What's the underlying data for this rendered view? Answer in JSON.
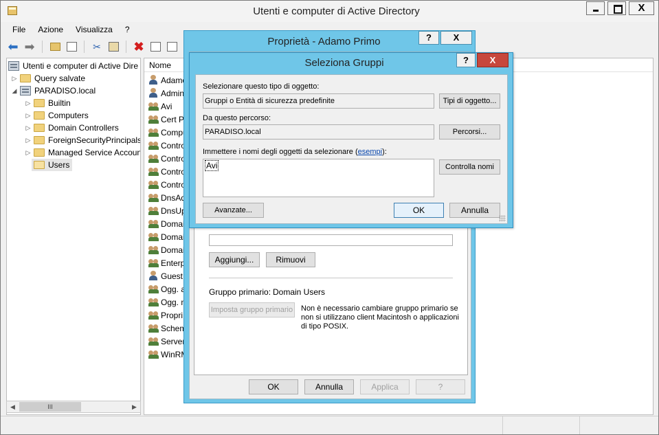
{
  "window": {
    "title": "Utenti e computer di Active Directory",
    "close_glyph": "X"
  },
  "menu": [
    "File",
    "Azione",
    "Visualizza",
    "?"
  ],
  "tree": {
    "root": "Utenti e computer di Active Dire",
    "items": [
      {
        "label": "Query salvate",
        "level": 1
      },
      {
        "label": "PARADISO.local",
        "level": 1
      },
      {
        "label": "Builtin",
        "level": 2
      },
      {
        "label": "Computers",
        "level": 2
      },
      {
        "label": "Domain Controllers",
        "level": 2
      },
      {
        "label": "ForeignSecurityPrincipals",
        "level": 2
      },
      {
        "label": "Managed Service Accoun",
        "level": 2
      },
      {
        "label": "Users",
        "level": 2
      }
    ],
    "scroll_thumb": "III"
  },
  "list": {
    "column_name": "Nome",
    "rows": [
      {
        "name": "Adamo",
        "kind": "user"
      },
      {
        "name": "Admin",
        "kind": "user"
      },
      {
        "name": "Avi",
        "kind": "group"
      },
      {
        "name": "Cert Pu",
        "kind": "group"
      },
      {
        "name": "Compu",
        "kind": "group"
      },
      {
        "name": "Contro",
        "kind": "group"
      },
      {
        "name": "Contro",
        "kind": "group"
      },
      {
        "name": "Contro",
        "kind": "group"
      },
      {
        "name": "Contro",
        "kind": "group"
      },
      {
        "name": "DnsAd",
        "kind": "group"
      },
      {
        "name": "DnsUp",
        "kind": "group"
      },
      {
        "name": "Domai",
        "kind": "group"
      },
      {
        "name": "Domai",
        "kind": "group"
      },
      {
        "name": "Domai",
        "kind": "group"
      },
      {
        "name": "Enterpr",
        "kind": "group"
      },
      {
        "name": "Guest",
        "kind": "user"
      },
      {
        "name": "Ogg. a",
        "kind": "group"
      },
      {
        "name": "Ogg. n",
        "kind": "group"
      },
      {
        "name": "Propri",
        "kind": "group"
      },
      {
        "name": "Schem",
        "kind": "group"
      },
      {
        "name": "Server",
        "kind": "group"
      },
      {
        "name": "WinRM",
        "kind": "group"
      }
    ]
  },
  "properties_dialog": {
    "title": "Proprietà - Adamo Primo",
    "help_glyph": "?",
    "close_glyph": "X",
    "add_button": "Aggiungi...",
    "remove_button": "Rimuovi",
    "primary_group_label": "Gruppo primario:",
    "primary_group_value": "Domain Users",
    "set_primary_button": "Imposta gruppo primario",
    "primary_note_1": "Non è necessario cambiare gruppo primario se",
    "primary_note_2": "non si utilizzano client Macintosh o applicazioni",
    "primary_note_3": "di tipo POSIX.",
    "ok": "OK",
    "cancel": "Annulla",
    "apply": "Applica",
    "help": "?"
  },
  "select_groups_dialog": {
    "title": "Seleziona Gruppi",
    "help_glyph": "?",
    "close_glyph": "X",
    "object_type_label": "Selezionare questo tipo di oggetto:",
    "object_type_value": "Gruppi o Entità di sicurezza predefinite",
    "object_types_button": "Tipi di oggetto...",
    "location_label": "Da questo percorso:",
    "location_value": "PARADISO.local",
    "locations_button": "Percorsi...",
    "names_label": "Immettere i nomi degli oggetti da selezionare (",
    "names_link": "esempi",
    "names_label_end": "):",
    "names_value": "Avi",
    "check_names_button": "Controlla nomi",
    "advanced_button": "Avanzate...",
    "ok": "OK",
    "cancel": "Annulla"
  }
}
